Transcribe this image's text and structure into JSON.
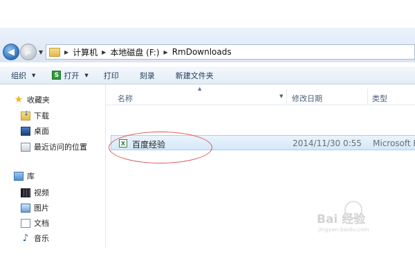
{
  "address_bar": {
    "breadcrumbs": [
      "计算机",
      "本地磁盘 (F:)",
      "RmDownloads"
    ]
  },
  "toolbar": {
    "organize": "组织",
    "open": "打开",
    "print": "打印",
    "burn": "刻录",
    "new_folder": "新建文件夹"
  },
  "nav": {
    "favorites": "收藏夹",
    "downloads": "下载",
    "desktop": "桌面",
    "recent": "最近访问的位置",
    "libraries": "库",
    "videos": "视频",
    "pictures": "图片",
    "documents": "文档",
    "music": "音乐"
  },
  "columns": {
    "name": "名称",
    "modified": "修改日期",
    "type": "类型"
  },
  "files": [
    {
      "name": "百度经验",
      "modified": "2014/11/30 0:55",
      "type": "Microsoft E"
    }
  ],
  "watermark": {
    "brand": "Bai 经验",
    "url": "jingyan.baidu.com"
  },
  "colors": {
    "selection": "#d4e8fa",
    "annotation": "#d9534f"
  },
  "icons": [
    "back-arrow",
    "forward-arrow",
    "folder",
    "star",
    "download-folder",
    "desktop",
    "recent-places",
    "library",
    "video",
    "picture",
    "document",
    "music-note",
    "excel-file"
  ]
}
